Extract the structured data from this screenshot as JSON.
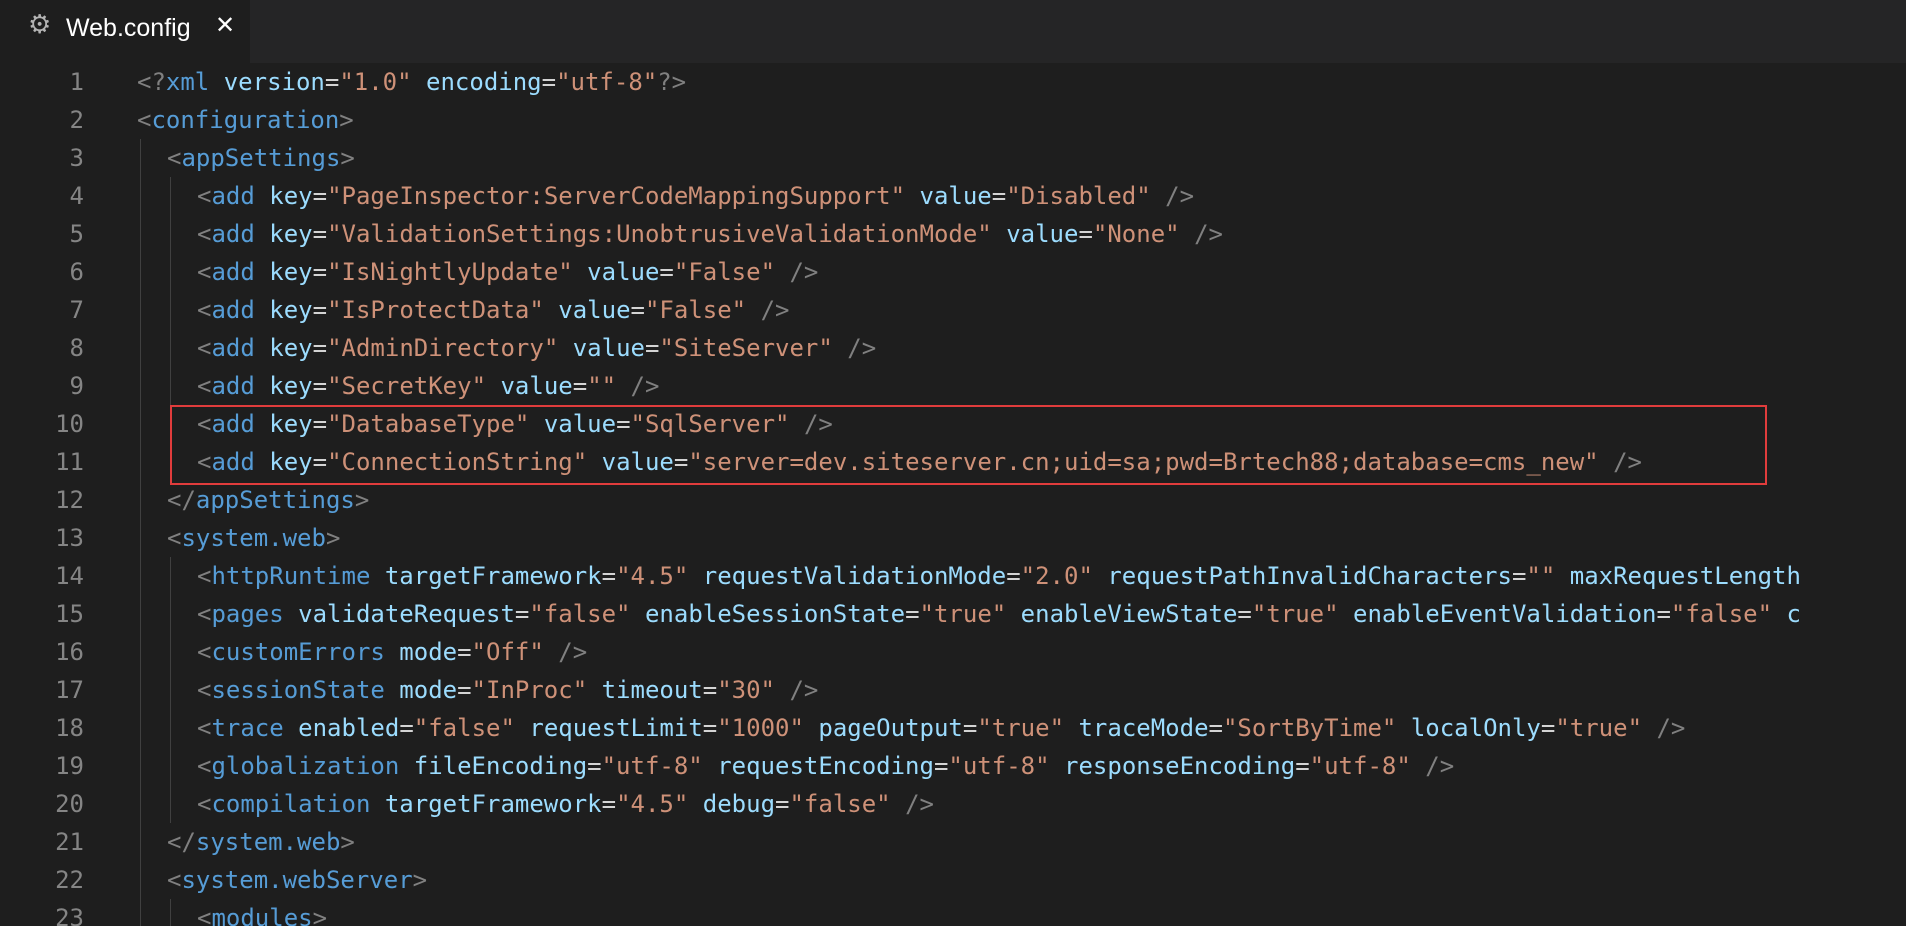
{
  "tab": {
    "title": "Web.config",
    "icon": "gear-icon",
    "close_glyph": "✕"
  },
  "colors": {
    "background": "#1e1e1e",
    "tag": "#569cd6",
    "attribute": "#9cdcfe",
    "string": "#ce9178",
    "punctuation": "#808080",
    "line_number": "#858585",
    "highlight_border": "#e03c3c"
  },
  "highlight": {
    "lines": [
      10,
      11
    ]
  },
  "lines": [
    {
      "n": "1",
      "indent": 0,
      "tokens": [
        [
          "p",
          "<?"
        ],
        [
          "t",
          "xml"
        ],
        [
          "s",
          " "
        ],
        [
          "a",
          "version"
        ],
        [
          "e",
          "="
        ],
        [
          "v",
          "\"1.0\""
        ],
        [
          "s",
          " "
        ],
        [
          "a",
          "encoding"
        ],
        [
          "e",
          "="
        ],
        [
          "v",
          "\"utf-8\""
        ],
        [
          "p",
          "?>"
        ]
      ]
    },
    {
      "n": "2",
      "indent": 0,
      "tokens": [
        [
          "p",
          "<"
        ],
        [
          "t",
          "configuration"
        ],
        [
          "p",
          ">"
        ]
      ]
    },
    {
      "n": "3",
      "indent": 1,
      "tokens": [
        [
          "p",
          "<"
        ],
        [
          "t",
          "appSettings"
        ],
        [
          "p",
          ">"
        ]
      ]
    },
    {
      "n": "4",
      "indent": 2,
      "tokens": [
        [
          "p",
          "<"
        ],
        [
          "t",
          "add"
        ],
        [
          "s",
          " "
        ],
        [
          "a",
          "key"
        ],
        [
          "e",
          "="
        ],
        [
          "v",
          "\"PageInspector:ServerCodeMappingSupport\""
        ],
        [
          "s",
          " "
        ],
        [
          "a",
          "value"
        ],
        [
          "e",
          "="
        ],
        [
          "v",
          "\"Disabled\""
        ],
        [
          "s",
          " "
        ],
        [
          "p",
          "/>"
        ]
      ]
    },
    {
      "n": "5",
      "indent": 2,
      "tokens": [
        [
          "p",
          "<"
        ],
        [
          "t",
          "add"
        ],
        [
          "s",
          " "
        ],
        [
          "a",
          "key"
        ],
        [
          "e",
          "="
        ],
        [
          "v",
          "\"ValidationSettings:UnobtrusiveValidationMode\""
        ],
        [
          "s",
          " "
        ],
        [
          "a",
          "value"
        ],
        [
          "e",
          "="
        ],
        [
          "v",
          "\"None\""
        ],
        [
          "s",
          " "
        ],
        [
          "p",
          "/>"
        ]
      ]
    },
    {
      "n": "6",
      "indent": 2,
      "tokens": [
        [
          "p",
          "<"
        ],
        [
          "t",
          "add"
        ],
        [
          "s",
          " "
        ],
        [
          "a",
          "key"
        ],
        [
          "e",
          "="
        ],
        [
          "v",
          "\"IsNightlyUpdate\""
        ],
        [
          "s",
          " "
        ],
        [
          "a",
          "value"
        ],
        [
          "e",
          "="
        ],
        [
          "v",
          "\"False\""
        ],
        [
          "s",
          " "
        ],
        [
          "p",
          "/>"
        ]
      ]
    },
    {
      "n": "7",
      "indent": 2,
      "tokens": [
        [
          "p",
          "<"
        ],
        [
          "t",
          "add"
        ],
        [
          "s",
          " "
        ],
        [
          "a",
          "key"
        ],
        [
          "e",
          "="
        ],
        [
          "v",
          "\"IsProtectData\""
        ],
        [
          "s",
          " "
        ],
        [
          "a",
          "value"
        ],
        [
          "e",
          "="
        ],
        [
          "v",
          "\"False\""
        ],
        [
          "s",
          " "
        ],
        [
          "p",
          "/>"
        ]
      ]
    },
    {
      "n": "8",
      "indent": 2,
      "tokens": [
        [
          "p",
          "<"
        ],
        [
          "t",
          "add"
        ],
        [
          "s",
          " "
        ],
        [
          "a",
          "key"
        ],
        [
          "e",
          "="
        ],
        [
          "v",
          "\"AdminDirectory\""
        ],
        [
          "s",
          " "
        ],
        [
          "a",
          "value"
        ],
        [
          "e",
          "="
        ],
        [
          "v",
          "\"SiteServer\""
        ],
        [
          "s",
          " "
        ],
        [
          "p",
          "/>"
        ]
      ]
    },
    {
      "n": "9",
      "indent": 2,
      "tokens": [
        [
          "p",
          "<"
        ],
        [
          "t",
          "add"
        ],
        [
          "s",
          " "
        ],
        [
          "a",
          "key"
        ],
        [
          "e",
          "="
        ],
        [
          "v",
          "\"SecretKey\""
        ],
        [
          "s",
          " "
        ],
        [
          "a",
          "value"
        ],
        [
          "e",
          "="
        ],
        [
          "v",
          "\"\""
        ],
        [
          "s",
          " "
        ],
        [
          "p",
          "/>"
        ]
      ]
    },
    {
      "n": "10",
      "indent": 2,
      "tokens": [
        [
          "p",
          "<"
        ],
        [
          "t",
          "add"
        ],
        [
          "s",
          " "
        ],
        [
          "a",
          "key"
        ],
        [
          "e",
          "="
        ],
        [
          "v",
          "\"DatabaseType\""
        ],
        [
          "s",
          " "
        ],
        [
          "a",
          "value"
        ],
        [
          "e",
          "="
        ],
        [
          "v",
          "\"SqlServer\""
        ],
        [
          "s",
          " "
        ],
        [
          "p",
          "/>"
        ]
      ]
    },
    {
      "n": "11",
      "indent": 2,
      "tokens": [
        [
          "p",
          "<"
        ],
        [
          "t",
          "add"
        ],
        [
          "s",
          " "
        ],
        [
          "a",
          "key"
        ],
        [
          "e",
          "="
        ],
        [
          "v",
          "\"ConnectionString\""
        ],
        [
          "s",
          " "
        ],
        [
          "a",
          "value"
        ],
        [
          "e",
          "="
        ],
        [
          "v",
          "\"server=dev.siteserver.cn;uid=sa;pwd=Brtech88;database=cms_new\""
        ],
        [
          "s",
          " "
        ],
        [
          "p",
          "/>"
        ]
      ]
    },
    {
      "n": "12",
      "indent": 1,
      "tokens": [
        [
          "p",
          "</"
        ],
        [
          "t",
          "appSettings"
        ],
        [
          "p",
          ">"
        ]
      ]
    },
    {
      "n": "13",
      "indent": 1,
      "tokens": [
        [
          "p",
          "<"
        ],
        [
          "t",
          "system.web"
        ],
        [
          "p",
          ">"
        ]
      ]
    },
    {
      "n": "14",
      "indent": 2,
      "tokens": [
        [
          "p",
          "<"
        ],
        [
          "t",
          "httpRuntime"
        ],
        [
          "s",
          " "
        ],
        [
          "a",
          "targetFramework"
        ],
        [
          "e",
          "="
        ],
        [
          "v",
          "\"4.5\""
        ],
        [
          "s",
          " "
        ],
        [
          "a",
          "requestValidationMode"
        ],
        [
          "e",
          "="
        ],
        [
          "v",
          "\"2.0\""
        ],
        [
          "s",
          " "
        ],
        [
          "a",
          "requestPathInvalidCharacters"
        ],
        [
          "e",
          "="
        ],
        [
          "v",
          "\"\""
        ],
        [
          "s",
          " "
        ],
        [
          "a",
          "maxRequestLength"
        ]
      ]
    },
    {
      "n": "15",
      "indent": 2,
      "tokens": [
        [
          "p",
          "<"
        ],
        [
          "t",
          "pages"
        ],
        [
          "s",
          " "
        ],
        [
          "a",
          "validateRequest"
        ],
        [
          "e",
          "="
        ],
        [
          "v",
          "\"false\""
        ],
        [
          "s",
          " "
        ],
        [
          "a",
          "enableSessionState"
        ],
        [
          "e",
          "="
        ],
        [
          "v",
          "\"true\""
        ],
        [
          "s",
          " "
        ],
        [
          "a",
          "enableViewState"
        ],
        [
          "e",
          "="
        ],
        [
          "v",
          "\"true\""
        ],
        [
          "s",
          " "
        ],
        [
          "a",
          "enableEventValidation"
        ],
        [
          "e",
          "="
        ],
        [
          "v",
          "\"false\""
        ],
        [
          "s",
          " "
        ],
        [
          "a",
          "c"
        ]
      ]
    },
    {
      "n": "16",
      "indent": 2,
      "tokens": [
        [
          "p",
          "<"
        ],
        [
          "t",
          "customErrors"
        ],
        [
          "s",
          " "
        ],
        [
          "a",
          "mode"
        ],
        [
          "e",
          "="
        ],
        [
          "v",
          "\"Off\""
        ],
        [
          "s",
          " "
        ],
        [
          "p",
          "/>"
        ]
      ]
    },
    {
      "n": "17",
      "indent": 2,
      "tokens": [
        [
          "p",
          "<"
        ],
        [
          "t",
          "sessionState"
        ],
        [
          "s",
          " "
        ],
        [
          "a",
          "mode"
        ],
        [
          "e",
          "="
        ],
        [
          "v",
          "\"InProc\""
        ],
        [
          "s",
          " "
        ],
        [
          "a",
          "timeout"
        ],
        [
          "e",
          "="
        ],
        [
          "v",
          "\"30\""
        ],
        [
          "s",
          " "
        ],
        [
          "p",
          "/>"
        ]
      ]
    },
    {
      "n": "18",
      "indent": 2,
      "tokens": [
        [
          "p",
          "<"
        ],
        [
          "t",
          "trace"
        ],
        [
          "s",
          " "
        ],
        [
          "a",
          "enabled"
        ],
        [
          "e",
          "="
        ],
        [
          "v",
          "\"false\""
        ],
        [
          "s",
          " "
        ],
        [
          "a",
          "requestLimit"
        ],
        [
          "e",
          "="
        ],
        [
          "v",
          "\"1000\""
        ],
        [
          "s",
          " "
        ],
        [
          "a",
          "pageOutput"
        ],
        [
          "e",
          "="
        ],
        [
          "v",
          "\"true\""
        ],
        [
          "s",
          " "
        ],
        [
          "a",
          "traceMode"
        ],
        [
          "e",
          "="
        ],
        [
          "v",
          "\"SortByTime\""
        ],
        [
          "s",
          " "
        ],
        [
          "a",
          "localOnly"
        ],
        [
          "e",
          "="
        ],
        [
          "v",
          "\"true\""
        ],
        [
          "s",
          " "
        ],
        [
          "p",
          "/>"
        ]
      ]
    },
    {
      "n": "19",
      "indent": 2,
      "tokens": [
        [
          "p",
          "<"
        ],
        [
          "t",
          "globalization"
        ],
        [
          "s",
          " "
        ],
        [
          "a",
          "fileEncoding"
        ],
        [
          "e",
          "="
        ],
        [
          "v",
          "\"utf-8\""
        ],
        [
          "s",
          " "
        ],
        [
          "a",
          "requestEncoding"
        ],
        [
          "e",
          "="
        ],
        [
          "v",
          "\"utf-8\""
        ],
        [
          "s",
          " "
        ],
        [
          "a",
          "responseEncoding"
        ],
        [
          "e",
          "="
        ],
        [
          "v",
          "\"utf-8\""
        ],
        [
          "s",
          " "
        ],
        [
          "p",
          "/>"
        ]
      ]
    },
    {
      "n": "20",
      "indent": 2,
      "tokens": [
        [
          "p",
          "<"
        ],
        [
          "t",
          "compilation"
        ],
        [
          "s",
          " "
        ],
        [
          "a",
          "targetFramework"
        ],
        [
          "e",
          "="
        ],
        [
          "v",
          "\"4.5\""
        ],
        [
          "s",
          " "
        ],
        [
          "a",
          "debug"
        ],
        [
          "e",
          "="
        ],
        [
          "v",
          "\"false\""
        ],
        [
          "s",
          " "
        ],
        [
          "p",
          "/>"
        ]
      ]
    },
    {
      "n": "21",
      "indent": 1,
      "tokens": [
        [
          "p",
          "</"
        ],
        [
          "t",
          "system.web"
        ],
        [
          "p",
          ">"
        ]
      ]
    },
    {
      "n": "22",
      "indent": 1,
      "tokens": [
        [
          "p",
          "<"
        ],
        [
          "t",
          "system.webServer"
        ],
        [
          "p",
          ">"
        ]
      ]
    },
    {
      "n": "23",
      "indent": 2,
      "tokens": [
        [
          "p",
          "<"
        ],
        [
          "t",
          "modules"
        ],
        [
          "p",
          ">"
        ]
      ]
    }
  ]
}
